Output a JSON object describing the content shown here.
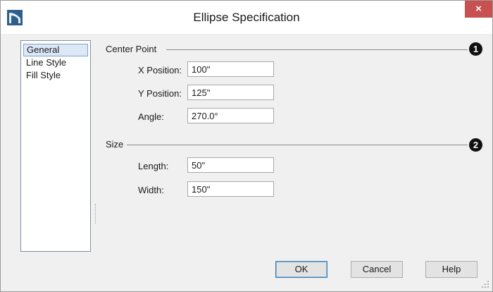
{
  "window": {
    "title": "Ellipse Specification",
    "close_symbol": "×",
    "icon": "app-logo-icon",
    "close_color": "#c75050"
  },
  "sidebar": {
    "items": [
      {
        "label": "General",
        "selected": true
      },
      {
        "label": "Line Style",
        "selected": false
      },
      {
        "label": "Fill Style",
        "selected": false
      }
    ]
  },
  "center_point": {
    "label": "Center Point",
    "callout": "1",
    "fields": [
      {
        "label": "X Position:",
        "value": "100\""
      },
      {
        "label": "Y Position:",
        "value": "125\""
      },
      {
        "label": "Angle:",
        "value": "270.0°"
      }
    ]
  },
  "size": {
    "label": "Size",
    "callout": "2",
    "fields": [
      {
        "label": "Length:",
        "value": "50\""
      },
      {
        "label": "Width:",
        "value": "150\""
      }
    ]
  },
  "buttons": {
    "ok": "OK",
    "cancel": "Cancel",
    "help": "Help"
  }
}
